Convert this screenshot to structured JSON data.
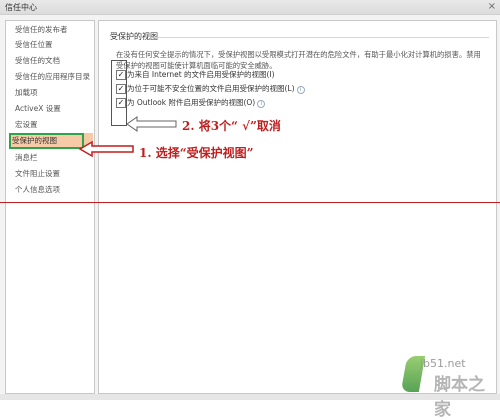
{
  "window": {
    "title": "信任中心",
    "close_glyph": "×"
  },
  "sidebar": {
    "items": [
      {
        "label": "受信任的发布者"
      },
      {
        "label": "受信任位置"
      },
      {
        "label": "受信任的文档"
      },
      {
        "label": "受信任的应用程序目录"
      },
      {
        "label": "加载项"
      },
      {
        "label": "ActiveX 设置"
      },
      {
        "label": "宏设置"
      },
      {
        "label": "受保护的视图",
        "selected": true
      },
      {
        "label": "消息栏"
      },
      {
        "label": "文件阻止设置"
      },
      {
        "label": "个人信息选项"
      }
    ]
  },
  "main": {
    "section_title": "受保护的视图",
    "description": "在没有任何安全提示的情况下，受保护视图以受限模式打开潜在的危险文件，有助于最小化对计算机的损害。禁用受保护的视图可能使计算机面临可能的安全威胁。",
    "options": [
      {
        "label": "为来自 Internet 的文件启用受保护的视图(I)",
        "checked": true,
        "check_glyph": "✓"
      },
      {
        "label": "为位于可能不安全位置的文件启用受保护的视图(L)",
        "checked": true,
        "check_glyph": "✓",
        "help_glyph": "i"
      },
      {
        "label": "为 Outlook 附件启用受保护的视图(O)",
        "checked": true,
        "check_glyph": "✓",
        "help_glyph": "i"
      }
    ]
  },
  "annotations": {
    "step1": "1. 选择“受保护视图”",
    "step2": "2. 将3个“ √”取消",
    "annotation_color": "#c01f1f",
    "highlight_color": "#2fa34a"
  },
  "watermark": {
    "site": "jb51.net",
    "name": "脚本之家"
  }
}
